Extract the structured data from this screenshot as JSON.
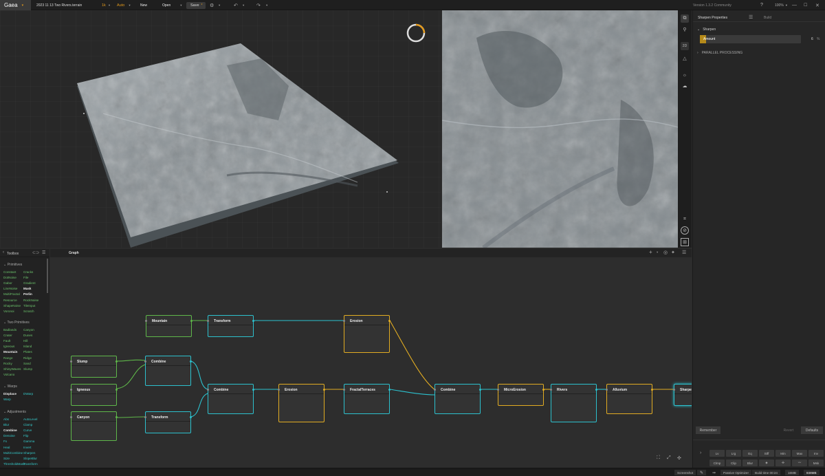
{
  "topbar": {
    "logo": "Gaea",
    "file_name": "2023 11 13 Two Rivers.terrain",
    "resolution": "1k",
    "build_mode": "Auto",
    "new_label": "New",
    "open_label": "Open",
    "save_label": "Save",
    "version": "Version 1.3.2 Community",
    "zoom": "100%"
  },
  "viewport_tools": [
    "2D"
  ],
  "right_panel": {
    "tab_properties": "Sharpen Properties",
    "tab_build": "Build",
    "section_title": "Sharpen",
    "amount_label": "Amount",
    "amount_value": "6",
    "amount_unit": "%",
    "parallel_label": "PARALLEL PROCESSING",
    "remember_label": "Remember",
    "revert_label": "Revert",
    "defaults_label": "Defaults",
    "filter_row1": [
      "Lv",
      "Lrg",
      "Eq",
      "Stff",
      "Min",
      "Max",
      "Inv"
    ],
    "filter_row2": [
      "Clmp",
      "Clip",
      "Blur",
      "",
      "",
      "",
      "Msk"
    ]
  },
  "toolbox": {
    "title": "Toolbox",
    "primitives_label": "Primitives",
    "primitives": [
      [
        "Constant",
        "Cracks"
      ],
      [
        "DotNoise",
        "File"
      ],
      [
        "Gabor",
        "Gradient"
      ],
      [
        "LineNoise",
        "Mask"
      ],
      [
        "MultiFractal",
        "Perlin"
      ],
      [
        "Resource",
        "RockNoise"
      ],
      [
        "ShapeNoise",
        "TileInput"
      ],
      [
        "Voronoi",
        "Scratch"
      ]
    ],
    "terrain_label": "Two Primitives",
    "terrain": [
      [
        "Badlands",
        "Canyon"
      ],
      [
        "Crater",
        "Dunes"
      ],
      [
        "Fault",
        "Hill"
      ],
      [
        "Igneous",
        "Island"
      ],
      [
        "Mountain",
        "Plates"
      ],
      [
        "Range",
        "Ridge"
      ],
      [
        "Rocky",
        "Sand"
      ],
      [
        "ShinyWaves",
        "Slump"
      ],
      [
        "Volcano",
        ""
      ]
    ],
    "warps_label": "Warps",
    "warps": [
      [
        "Displace",
        "DWarp"
      ],
      [
        "Warp",
        ""
      ]
    ],
    "adjust_label": "Adjustments",
    "adjust": [
      [
        "Abs",
        "AutoLevel"
      ],
      [
        "Blur",
        "Clamp"
      ],
      [
        "Combine",
        "Curve"
      ],
      [
        "Denoise",
        "Flip"
      ],
      [
        "Fx",
        "Gamma"
      ],
      [
        "Heal",
        "Invert"
      ],
      [
        "MultiCombine",
        "Sharpen"
      ],
      [
        "Size",
        "SlopeBlur"
      ],
      [
        "ThresholdMask",
        "Transform"
      ]
    ]
  },
  "graph": {
    "tab": "Graph",
    "nodes": [
      "Mountain",
      "Transform",
      "Erosion",
      "Slump",
      "Combine",
      "Igneous",
      "Combine",
      "Erosion",
      "FractalTerraces",
      "Combine",
      "MicroErosion",
      "Rivers",
      "Alluvium",
      "Sharpen",
      "Canyon",
      "Transform"
    ]
  },
  "statusbar": {
    "screenshot": "Screenshot",
    "optimizer": "Passive Optimizer",
    "build_time": "Build time 00:24",
    "vram": "16MB",
    "ram": "848MB"
  }
}
